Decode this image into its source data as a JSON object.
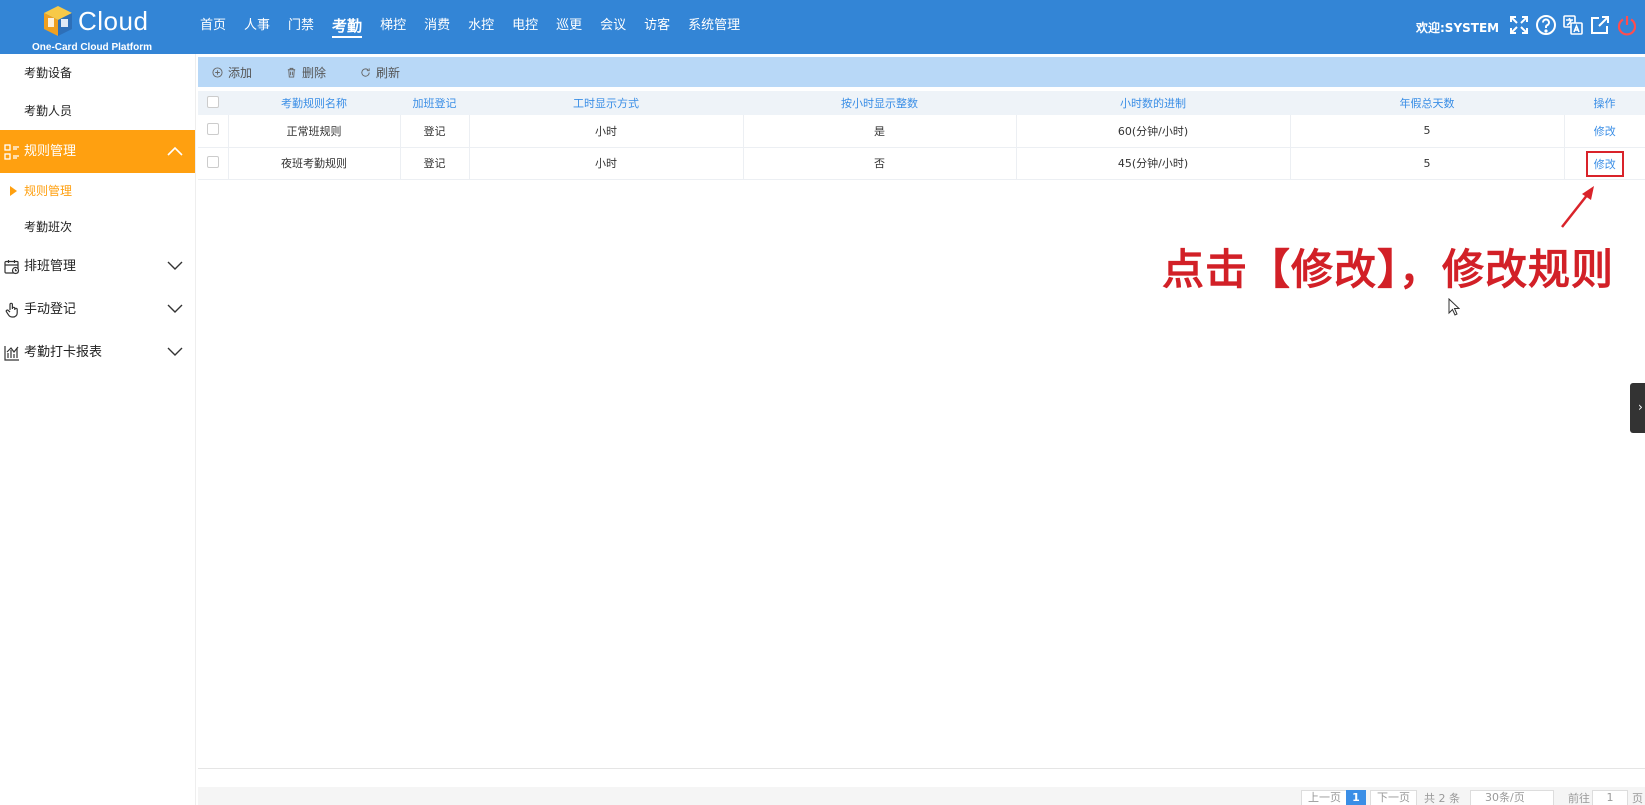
{
  "header": {
    "logo_text": "Cloud",
    "logo_sub": "One-Card Cloud Platform",
    "nav": [
      {
        "label": "首页"
      },
      {
        "label": "人事"
      },
      {
        "label": "门禁"
      },
      {
        "label": "考勤",
        "active": true
      },
      {
        "label": "梯控"
      },
      {
        "label": "消费"
      },
      {
        "label": "水控"
      },
      {
        "label": "电控"
      },
      {
        "label": "巡更"
      },
      {
        "label": "会议"
      },
      {
        "label": "访客"
      },
      {
        "label": "系统管理"
      }
    ],
    "welcome": "欢迎:SYSTEM",
    "icons": [
      "fullscreen-icon",
      "help-icon",
      "language-icon",
      "external-link-icon",
      "power-icon"
    ]
  },
  "sidebar": {
    "top_items": [
      "考勤设备",
      "考勤人员"
    ],
    "active_group": "规则管理",
    "active_group_subs": [
      "规则管理",
      "考勤班次"
    ],
    "groups": [
      "排班管理",
      "手动登记",
      "考勤打卡报表"
    ]
  },
  "toolbar": {
    "add": "添加",
    "delete": "删除",
    "refresh": "刷新"
  },
  "table": {
    "columns": [
      "考勤规则名称",
      "加班登记",
      "工时显示方式",
      "按小时显示整数",
      "小时数的进制",
      "年假总天数",
      "操作"
    ],
    "rows": [
      {
        "name": "正常班规则",
        "overtime": "登记",
        "display": "小时",
        "integer": "是",
        "base": "60(分钟/小时)",
        "annual": "5",
        "action": "修改"
      },
      {
        "name": "夜班考勤规则",
        "overtime": "登记",
        "display": "小时",
        "integer": "否",
        "base": "45(分钟/小时)",
        "annual": "5",
        "action": "修改"
      }
    ]
  },
  "annotation": "点击【修改】，修改规则",
  "pager": {
    "prev": "上一页",
    "current": "1",
    "next": "下一页",
    "total": "共 2 条",
    "page_size": "30条/页",
    "goto": "前往",
    "goto_value": "1",
    "page_unit": "页"
  },
  "colors": {
    "header_bg": "#3385d6",
    "active_group_bg": "#ffa010",
    "link": "#3a8ee6",
    "annotation": "#d22027"
  }
}
